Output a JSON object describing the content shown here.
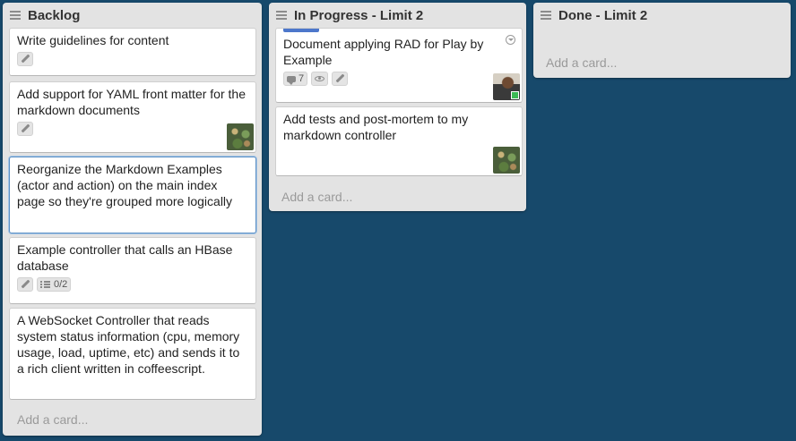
{
  "lists": [
    {
      "title": "Backlog",
      "cards": [
        {
          "text": "Write guidelines for content"
        },
        {
          "text": "Add support for YAML front matter for the markdown documents"
        },
        {
          "text": "Reorganize the Markdown Examples (actor and action) on the main index page so they're grouped more logically"
        },
        {
          "text": "Example controller that calls an HBase database",
          "checklist": "0/2"
        },
        {
          "text": "A WebSocket Controller that reads system status information (cpu, memory usage, load, uptime, etc) and sends it to a rich client written in coffeescript."
        }
      ],
      "add_card": "Add a card..."
    },
    {
      "title": "In Progress - Limit 2",
      "cards": [
        {
          "text": "Document applying RAD for Play by Example",
          "comments": "7"
        },
        {
          "text": "Add tests and post-mortem to my markdown controller"
        }
      ],
      "add_card": "Add a card..."
    },
    {
      "title": "Done - Limit 2",
      "cards": [],
      "add_card": "Add a card..."
    }
  ],
  "colors": {
    "board_bg": "#17496b",
    "list_bg": "#e3e3e3",
    "label_blue": "#4d77cb",
    "online_green": "#3cba54"
  },
  "icons": [
    "list-menu-icon",
    "pencil-icon",
    "comment-icon",
    "eye-icon",
    "checklist-icon",
    "card-menu-icon"
  ]
}
